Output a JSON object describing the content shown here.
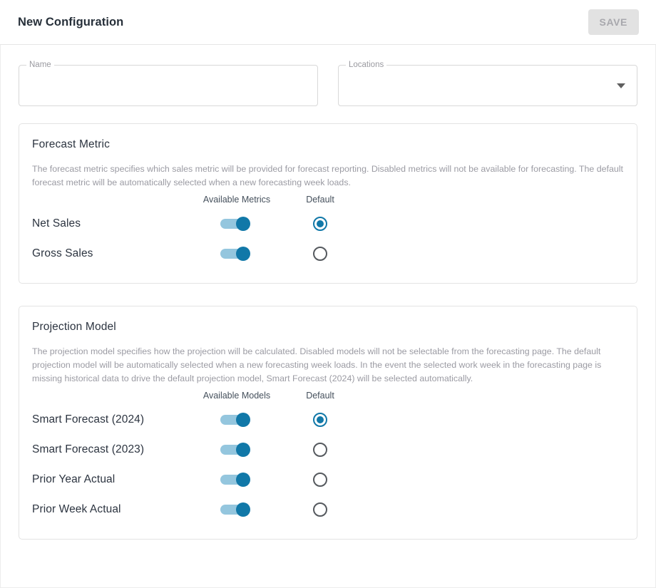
{
  "header": {
    "title": "New Configuration",
    "save_label": "SAVE"
  },
  "form": {
    "name_field": {
      "label": "Name",
      "value": "",
      "placeholder": ""
    },
    "locations_field": {
      "label": "Locations",
      "value": "",
      "placeholder": "",
      "caret_icon": "chevron-down-icon"
    }
  },
  "forecast_metric": {
    "title": "Forecast Metric",
    "description": "The forecast metric specifies which sales metric will be provided for forecast reporting. Disabled metrics will not be available for forecasting. The default forecast metric will be automatically selected when a new forecasting week loads.",
    "columns": {
      "available": "Available Metrics",
      "default": "Default"
    },
    "rows": [
      {
        "label": "Net Sales",
        "enabled": true,
        "is_default": true
      },
      {
        "label": "Gross Sales",
        "enabled": true,
        "is_default": false
      }
    ]
  },
  "projection_model": {
    "title": "Projection Model",
    "description": "The projection model specifies how the projection will be calculated. Disabled models will not be selectable from the forecasting page. The default projection model will be automatically selected when a new forecasting week loads. In the event the selected work week in the forecasting page is missing historical data to drive the default projection model, Smart Forecast (2024) will be selected automatically.",
    "columns": {
      "available": "Available Models",
      "default": "Default"
    },
    "rows": [
      {
        "label": "Smart Forecast (2024)",
        "enabled": true,
        "is_default": true
      },
      {
        "label": "Smart Forecast (2023)",
        "enabled": true,
        "is_default": false
      },
      {
        "label": "Prior Year Actual",
        "enabled": true,
        "is_default": false
      },
      {
        "label": "Prior Week Actual",
        "enabled": true,
        "is_default": false
      }
    ]
  },
  "colors": {
    "accent": "#1178a8",
    "track": "#94c6de",
    "radio_off": "#55595e",
    "disabled_button_bg": "#e2e2e2",
    "disabled_button_text": "#a8a8ad",
    "description_text": "#9b9ba3"
  }
}
